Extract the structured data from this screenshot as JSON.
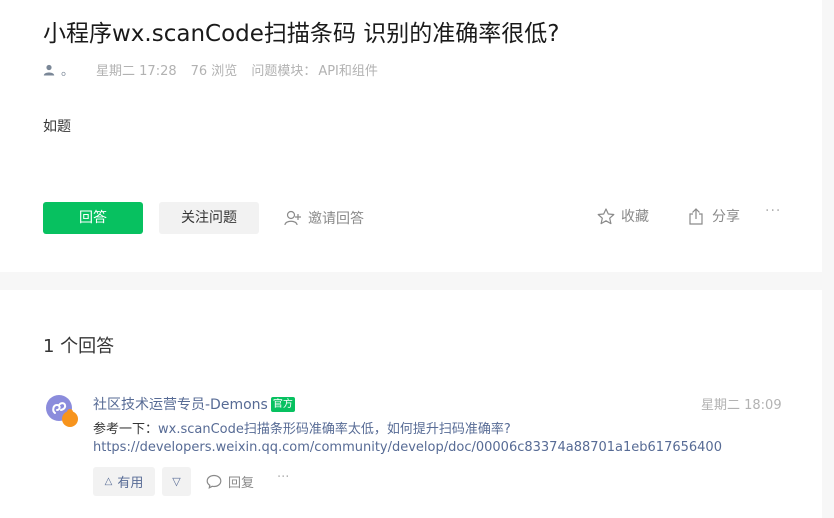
{
  "question": {
    "title": "小程序wx.scanCode扫描条码 识别的准确率很低?",
    "author_name": "。",
    "time": "星期二 17:28",
    "views": "76 浏览",
    "module_label": "问题模块：",
    "module_value": "API和组件",
    "body": "如题"
  },
  "actions": {
    "answer_label": "回答",
    "follow_label": "关注问题",
    "invite_label": "邀请回答",
    "collect_label": "收藏",
    "share_label": "分享",
    "more_label": "···"
  },
  "answers_section": {
    "count_label": "1 个回答"
  },
  "answer": {
    "author": "社区技术运营专员-Demons",
    "badge": "官方",
    "time": "星期二 18:09",
    "prefix": "参考一下：",
    "link_text": "wx.scanCode扫描条形码准确率太低，如何提升扫码准确率?",
    "url": "https://developers.weixin.qq.com/community/develop/doc/00006c83374a88701a1eb617656400",
    "useful_label": "有用",
    "reply_label": "回复",
    "more_label": "···"
  },
  "colors": {
    "accent_green": "#07c160",
    "link_blue": "#576b95"
  }
}
